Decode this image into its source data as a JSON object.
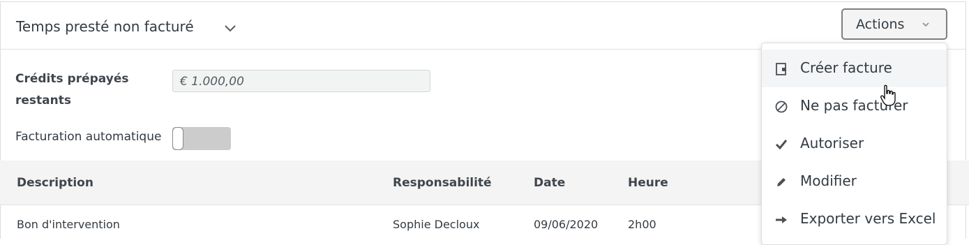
{
  "header": {
    "title": "Temps presté non facturé",
    "actions_label": "Actions"
  },
  "credits": {
    "label": "Crédits prépayés restants",
    "value": "€ 1.000,00"
  },
  "auto_billing": {
    "label": "Facturation automatique",
    "enabled": false
  },
  "table": {
    "columns": [
      "Description",
      "Responsabilité",
      "Date",
      "Heure"
    ],
    "rows": [
      [
        "Bon d'intervention",
        "Sophie Decloux",
        "09/06/2020",
        "2h00"
      ]
    ]
  },
  "actions_menu": {
    "items": [
      {
        "label": "Créer facture",
        "icon": "invoice-icon",
        "hover": true
      },
      {
        "label": "Ne pas facturer",
        "icon": "ban-icon"
      },
      {
        "label": "Autoriser",
        "icon": "checkmark-icon"
      },
      {
        "label": "Modifier",
        "icon": "pencil-icon"
      },
      {
        "label": "Exporter vers Excel",
        "icon": "arrow-right-icon"
      }
    ]
  }
}
